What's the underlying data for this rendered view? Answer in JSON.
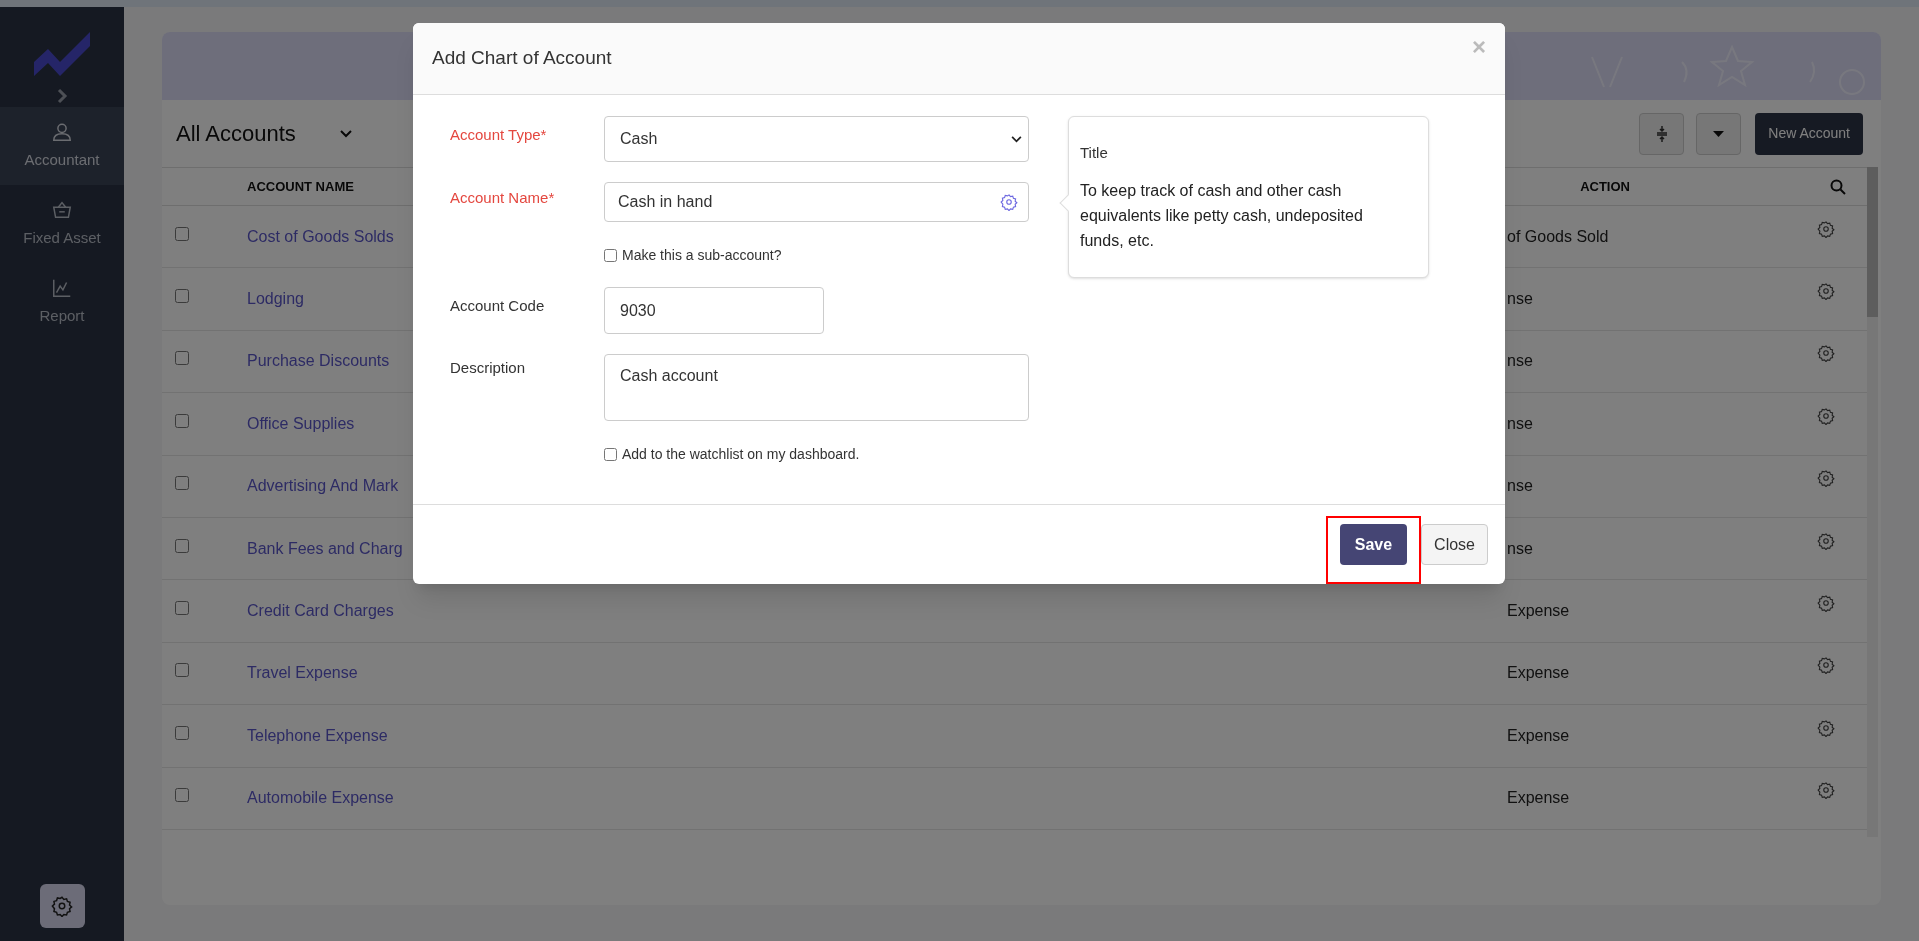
{
  "sidebar": {
    "items": [
      {
        "label": "Accountant",
        "selected": true
      },
      {
        "label": "Fixed Asset",
        "selected": false
      },
      {
        "label": "Report",
        "selected": false
      }
    ]
  },
  "toolbar": {
    "view": "All Accounts",
    "new_button": "New Account"
  },
  "table": {
    "columns": [
      "ACCOUNT NAME",
      "ACTION"
    ],
    "rows": [
      {
        "name": "Cost of Goods Solds",
        "type": "of Goods Sold",
        "checked": false
      },
      {
        "name": "Lodging",
        "type": "nse",
        "checked": false
      },
      {
        "name": "Purchase Discounts",
        "type": "nse",
        "checked": false
      },
      {
        "name": "Office Supplies",
        "type": "nse",
        "checked": false
      },
      {
        "name": "Advertising And Mark",
        "type": "nse",
        "checked": false
      },
      {
        "name": "Bank Fees and Charg",
        "type": "nse",
        "checked": false
      },
      {
        "name": "Credit Card Charges",
        "type": "Expense",
        "checked": false
      },
      {
        "name": "Travel Expense",
        "type": "Expense",
        "checked": false
      },
      {
        "name": "Telephone Expense",
        "type": "Expense",
        "checked": false
      },
      {
        "name": "Automobile Expense",
        "type": "Expense",
        "checked": false
      }
    ]
  },
  "modal": {
    "title": "Add Chart of Account",
    "close": "×",
    "fields": [
      {
        "kind": "select",
        "label": "Account Type*",
        "required": true,
        "value": "Cash"
      },
      {
        "kind": "text_icon",
        "label": "Account Name*",
        "required": true,
        "value": "Cash in hand"
      },
      {
        "kind": "checkbox",
        "label": "Make this a sub-account?",
        "checked": false
      },
      {
        "kind": "short_text",
        "label": "Account Code",
        "required": false,
        "value": "9030"
      },
      {
        "kind": "textarea",
        "label": "Description",
        "required": false,
        "value": "Cash account"
      },
      {
        "kind": "checkbox",
        "label": "Add to the watchlist on my dashboard.",
        "checked": false
      }
    ],
    "popover": {
      "title": "Title",
      "text": "To keep track of cash and other cash equivalents like petty cash, undeposited funds, etc."
    },
    "buttons": [
      {
        "label": "Save",
        "kind": "primary",
        "highlighted": true
      },
      {
        "label": "Close",
        "kind": "secondary",
        "highlighted": false
      }
    ]
  }
}
